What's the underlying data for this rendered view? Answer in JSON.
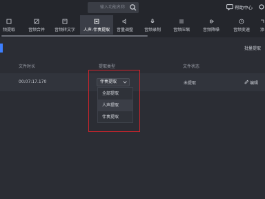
{
  "app": {
    "search": {
      "placeholder": "输入功能名称"
    },
    "help_label": "帮助中心"
  },
  "toolbar": {
    "items": [
      {
        "label": "频提取",
        "icon": "export-icon"
      },
      {
        "label": "音频合并",
        "icon": "merge-icon"
      },
      {
        "label": "音频转文字",
        "icon": "text-icon"
      },
      {
        "label": "人声-伴奏提取",
        "icon": "vocal-separate-icon",
        "active": true
      },
      {
        "label": "音量调整",
        "icon": "volume-icon"
      },
      {
        "label": "音频录制",
        "icon": "mic-icon"
      },
      {
        "label": "音频压缩",
        "icon": "compress-icon"
      },
      {
        "label": "音频降噪",
        "icon": "denoise-icon"
      },
      {
        "label": "音频变速",
        "icon": "speed-icon"
      },
      {
        "label": "添",
        "icon": "add-icon"
      }
    ]
  },
  "main": {
    "batch_label": "批量提取",
    "headers": {
      "duration": "文件时长",
      "type": "提取类型",
      "status": "文件状态"
    },
    "row": {
      "duration": "00:07:17.170",
      "type": "伴奏提取",
      "status": "未提取",
      "edit": "编辑"
    },
    "menu": [
      {
        "label": "全部提取"
      },
      {
        "label": "人声提取",
        "highlighted": true
      },
      {
        "label": "伴奏提取"
      }
    ]
  },
  "colors": {
    "accent": "#3d7fff",
    "highlight_box": "#d1232b"
  }
}
